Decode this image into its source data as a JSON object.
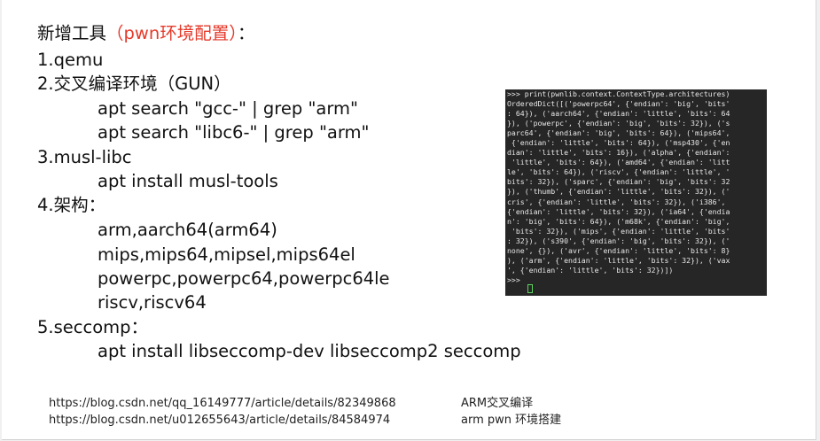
{
  "slide": {
    "title_prefix": "新增工具",
    "title_paren": "（pwn环境配置）",
    "title_suffix": "：",
    "item1": "1.qemu",
    "item2": "2.交叉编译环境（GUN）",
    "item2_cmd1": "apt search \"gcc-\" | grep \"arm\"",
    "item2_cmd2": "apt search \"libc6-\" | grep \"arm\"",
    "item3": "3.musl-libc",
    "item3_cmd": "apt install musl-tools",
    "item4": "4.架构：",
    "arch_line1": "arm,aarch64(arm64)",
    "arch_line2": "mips,mips64,mipsel,mips64el",
    "arch_line3": "powerpc,powerpc64,powerpc64le",
    "arch_line4": "riscv,riscv64",
    "item5": "5.seccomp：",
    "item5_cmd": "apt install libseccomp-dev libseccomp2 seccomp",
    "link1_url": "https://blog.csdn.net/qq_16149777/article/details/82349868",
    "link1_note": "ARM交叉编译",
    "link2_url": "https://blog.csdn.net/u012655643/article/details/84584974",
    "link2_note": "arm  pwn 环境搭建"
  },
  "terminal": {
    "lines": ">>> print(pwnlib.context.ContextType.architectures)\nOrderedDict([('powerpc64', {'endian': 'big', 'bits'\n: 64}), ('aarch64', {'endian': 'little', 'bits': 64\n}), ('powerpc', {'endian': 'big', 'bits': 32}), ('s\nparc64', {'endian': 'big', 'bits': 64}), ('mips64',\n {'endian': 'little', 'bits': 64}), ('msp430', {'en\ndian': 'little', 'bits': 16}), ('alpha', {'endian':\n 'little', 'bits': 64}), ('amd64', {'endian': 'litt\nle', 'bits': 64}), ('riscv', {'endian': 'little', '\nbits': 32}), ('sparc', {'endian': 'big', 'bits': 32\n}), ('thumb', {'endian': 'little', 'bits': 32}), ('\ncris', {'endian': 'little', 'bits': 32}), ('i386',\n{'endian': 'little', 'bits': 32}), ('ia64', {'endia\nn': 'big', 'bits': 64}), ('m68k', {'endian': 'big',\n 'bits': 32}), ('mips', {'endian': 'little', 'bits'\n: 32}), ('s390', {'endian': 'big', 'bits': 32}), ('\nnone', {}), ('avr', {'endian': 'little', 'bits': 8}\n), ('arm', {'endian': 'little', 'bits': 32}), ('vax\n', {'endian': 'little', 'bits': 32})])\n>>> "
  },
  "colors": {
    "accent_red": "#e53a2b",
    "terminal_bg": "#262626"
  }
}
